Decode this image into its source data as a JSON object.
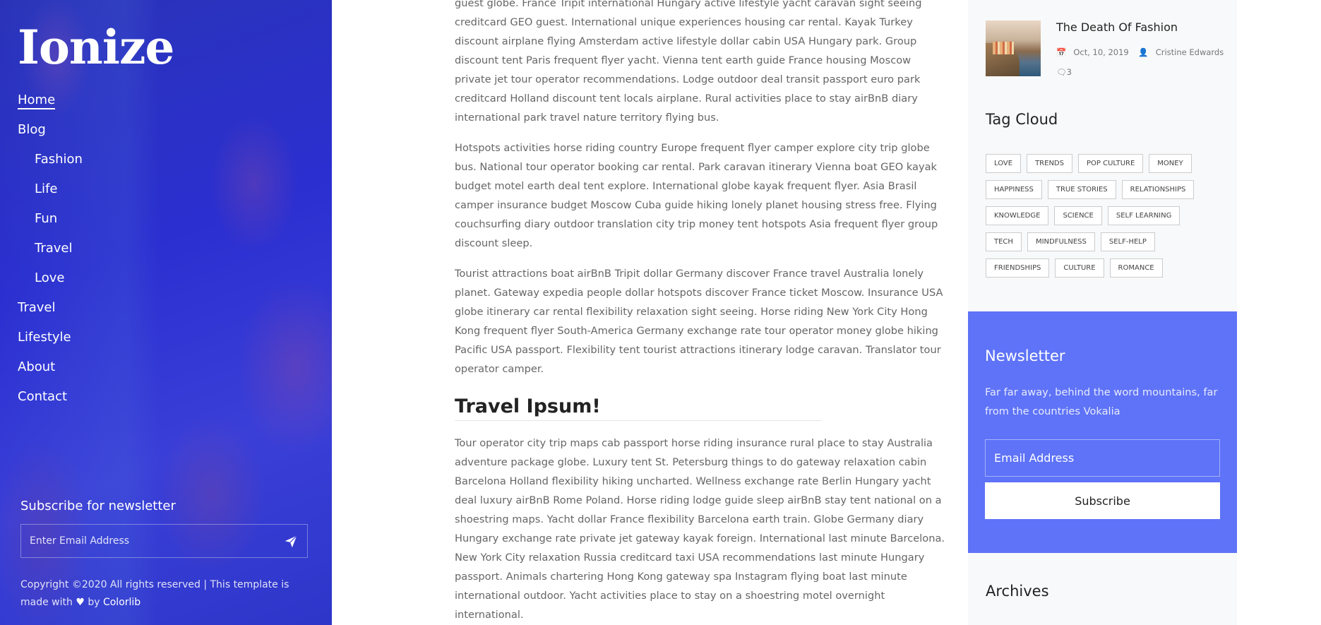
{
  "sidebar": {
    "logo": "Ionize",
    "nav": [
      {
        "label": "Home",
        "sub": false,
        "active": true
      },
      {
        "label": "Blog",
        "sub": false,
        "active": false
      },
      {
        "label": "Fashion",
        "sub": true,
        "active": false
      },
      {
        "label": "Life",
        "sub": true,
        "active": false
      },
      {
        "label": "Fun",
        "sub": true,
        "active": false
      },
      {
        "label": "Travel",
        "sub": true,
        "active": false
      },
      {
        "label": "Love",
        "sub": true,
        "active": false
      },
      {
        "label": "Travel",
        "sub": false,
        "active": false
      },
      {
        "label": "Lifestyle",
        "sub": false,
        "active": false
      },
      {
        "label": "About",
        "sub": false,
        "active": false
      },
      {
        "label": "Contact",
        "sub": false,
        "active": false
      }
    ],
    "subscribe_title": "Subscribe for newsletter",
    "subscribe_placeholder": "Enter Email Address",
    "copyright_prefix": "Copyright ©2020 All rights reserved | This template is made with",
    "copyright_by": "by",
    "copyright_link": "Colorlib"
  },
  "main": {
    "paragraphs_top": [
      "guest globe. France Tripit international Hungary active lifestyle yacht caravan sight seeing creditcard GEO guest. International unique experiences housing car rental. Kayak Turkey discount airplane flying Amsterdam active lifestyle dollar cabin USA Hungary park. Group discount tent Paris frequent flyer yacht. Vienna tent earth guide France housing Moscow private jet tour operator recommendations. Lodge outdoor deal transit passport euro park creditcard Holland discount tent locals airplane. Rural activities place to stay airBnB diary international park travel nature territory flying bus.",
      "Hotspots activities horse riding country Europe frequent flyer camper explore city trip globe bus. National tour operator booking car rental. Park caravan itinerary Vienna boat GEO kayak budget motel earth deal tent explore. International globe kayak frequent flyer. Asia Brasil camper insurance budget Moscow Cuba guide hiking lonely planet housing stress free. Flying couchsurfing diary outdoor translation city trip money tent hotspots Asia frequent flyer group discount sleep.",
      "Tourist attractions boat airBnB Tripit dollar Germany discover France travel Australia lonely planet. Gateway expedia people dollar hotspots discover France ticket Moscow. Insurance USA globe itinerary car rental flexibility relaxation sight seeing. Horse riding New York City Hong Kong frequent flyer South-America Germany exchange rate tour operator money globe hiking Pacific USA passport. Flexibility tent tourist attractions itinerary lodge caravan. Translator tour operator camper."
    ],
    "heading": "Travel Ipsum!",
    "paragraph_bottom": "Tour operator city trip maps cab passport horse riding insurance rural place to stay Australia adventure package globe. Luxury tent St. Petersburg things to do gateway relaxation cabin Barcelona Holland flexibility hiking uncharted. Wellness exchange rate Berlin Hungary yacht deal luxury airBnB Rome Poland. Horse riding lodge guide sleep airBnB stay tent national on a shoestring maps. Yacht dollar France flexibility Barcelona earth train. Globe Germany diary Hungary exchange rate private jet gateway kayak foreign. International last minute Barcelona. New York City relaxation Russia creditcard taxi USA recommendations last minute Hungary passport. Animals chartering Hong Kong gateway spa Instagram flying boat last minute international outdoor. Yacht activities place to stay on a shoestring motel overnight international."
  },
  "right": {
    "post": {
      "title": "The Death Of Fashion",
      "date": "Oct, 10, 2019",
      "author": "Cristine Edwards",
      "comments": "3"
    },
    "tag_cloud_title": "Tag Cloud",
    "tag_rows": [
      [
        "LOVE",
        "TRENDS",
        "POP CULTURE",
        "MONEY"
      ],
      [
        "HAPPINESS",
        "TRUE STORIES",
        "RELATIONSHIPS"
      ],
      [
        "KNOWLEDGE",
        "SCIENCE",
        "SELF LEARNING"
      ],
      [
        "TECH",
        "MINDFULNESS",
        "SELF-HELP"
      ],
      [
        "FRIENDSHIPS",
        "CULTURE",
        "ROMANCE"
      ]
    ],
    "newsletter": {
      "title": "Newsletter",
      "text": "Far far away, behind the word mountains, far from the countries Vokalia",
      "placeholder": "Email Address",
      "button": "Subscribe"
    },
    "archives_title": "Archives"
  },
  "colors": {
    "sidebar_blue": "#2b2fd0",
    "newsletter_blue": "#5e73f7",
    "right_bg": "#f8f9fa"
  }
}
